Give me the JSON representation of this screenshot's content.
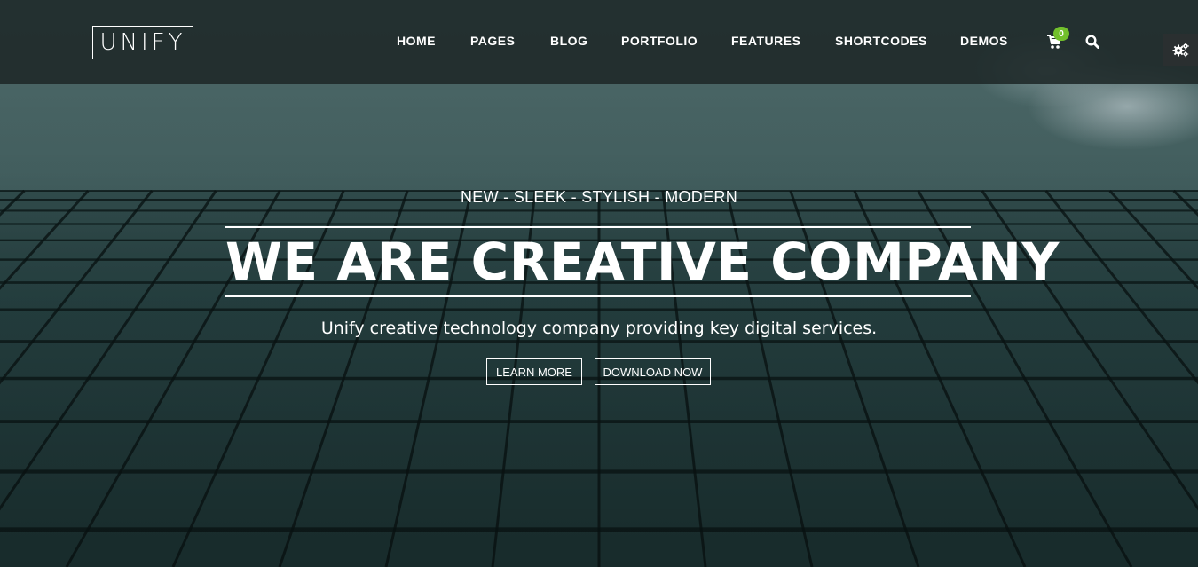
{
  "header": {
    "logo_text": "UNIFY",
    "nav": [
      {
        "label": "HOME"
      },
      {
        "label": "PAGES"
      },
      {
        "label": "BLOG"
      },
      {
        "label": "PORTFOLIO"
      },
      {
        "label": "FEATURES"
      },
      {
        "label": "SHORTCODES"
      },
      {
        "label": "DEMOS"
      }
    ],
    "cart_count": "0",
    "icons": [
      "shopping-cart-icon",
      "search-icon",
      "gears-icon"
    ]
  },
  "hero": {
    "tagline": "NEW - SLEEK - STYLISH - MODERN",
    "headline": "WE ARE CREATIVE COMPANY",
    "subtext": "Unify creative technology company providing key digital services.",
    "buttons": {
      "learn_more": "LEARN MORE",
      "download_now": "DOWNLOAD NOW"
    }
  },
  "colors": {
    "accent_green": "#72c02c",
    "header_bg": "#1e2828",
    "text": "#ffffff"
  }
}
